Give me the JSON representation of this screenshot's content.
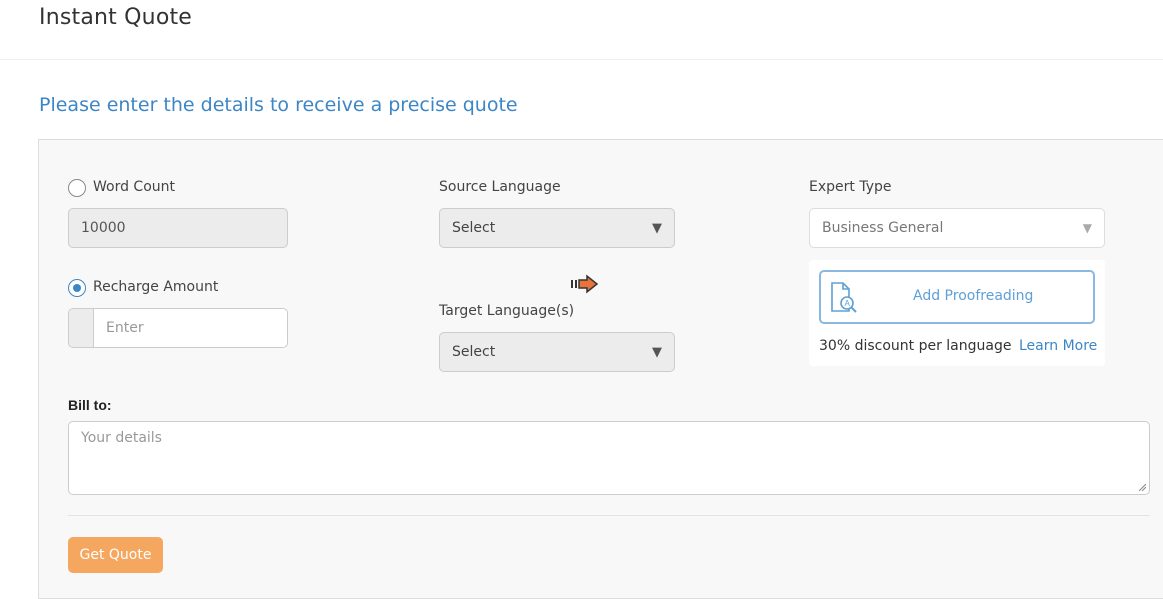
{
  "header": {
    "title": "Instant Quote"
  },
  "form": {
    "subtitle": "Please enter the details to receive a precise quote",
    "word_count": {
      "label": "Word Count",
      "value": "10000",
      "selected": false
    },
    "recharge_amount": {
      "label": "Recharge Amount",
      "placeholder": "Enter",
      "selected": true
    },
    "source_language": {
      "label": "Source Language",
      "value": "Select"
    },
    "target_language": {
      "label": "Target Language(s)",
      "value": "Select"
    },
    "expert_type": {
      "label": "Expert Type",
      "value": "Business General"
    },
    "proofreading": {
      "button_label": "Add Proofreading",
      "discount_text": "30% discount per language",
      "learn_more": "Learn More"
    },
    "bill_to": {
      "label": "Bill to:",
      "placeholder": "Your details"
    },
    "submit_label": "Get Quote"
  },
  "colors": {
    "accent_blue": "#3d86c6",
    "button_orange": "#f5a760",
    "swap_arrow": "#e8743b"
  },
  "icons": {
    "swap": "swap-languages-icon",
    "proofreading": "document-search-icon",
    "caret": "caret-down-icon"
  }
}
